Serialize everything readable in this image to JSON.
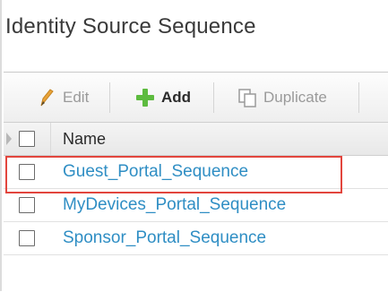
{
  "page": {
    "title": "Identity Source Sequence"
  },
  "toolbar": {
    "edit_label": "Edit",
    "add_label": "Add",
    "duplicate_label": "Duplicate"
  },
  "table": {
    "header": {
      "name": "Name"
    },
    "rows": [
      {
        "name": "Guest_Portal_Sequence",
        "highlighted": true
      },
      {
        "name": "MyDevices_Portal_Sequence",
        "highlighted": false
      },
      {
        "name": "Sponsor_Portal_Sequence",
        "highlighted": false
      }
    ]
  },
  "icons": {
    "edit": "pencil-icon",
    "add": "plus-icon",
    "duplicate": "duplicate-icon"
  },
  "colors": {
    "link": "#2f8ec4",
    "highlight_border": "#e2453d",
    "add_icon": "#5dbb3f",
    "edit_icon": "#e8a33a"
  }
}
